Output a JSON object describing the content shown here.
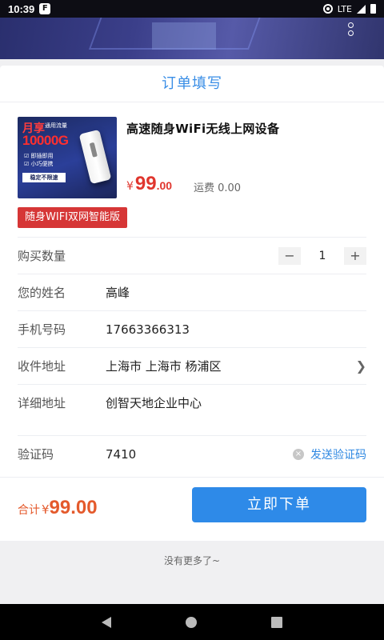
{
  "status_bar": {
    "time": "10:39",
    "notif_icon": "F",
    "network": "LTE"
  },
  "header": {
    "title": "订单填写"
  },
  "product": {
    "thumb": {
      "brand": "月享",
      "traffic_label": "通用流量",
      "traffic": "10000G",
      "feature1": "☑ 即插即用",
      "feature2": "☑ 小巧便携",
      "badge": "稳定不限速"
    },
    "name": "高速随身WiFi无线上网设备",
    "price_currency": "¥",
    "price_int": "99",
    "price_dec": ".00",
    "shipping": "运费 0.00",
    "variant_tag": "随身WIFI双网智能版"
  },
  "form": {
    "quantity": {
      "label": "购买数量",
      "minus": "−",
      "value": "1",
      "plus": "+"
    },
    "name": {
      "label": "您的姓名",
      "value": "高峰"
    },
    "phone": {
      "label": "手机号码",
      "value": "17663366313"
    },
    "region": {
      "label": "收件地址",
      "value": "上海市 上海市 杨浦区"
    },
    "address": {
      "label": "详细地址",
      "value": "创智天地企业中心"
    },
    "verify": {
      "label": "验证码",
      "value": "7410",
      "clear": "×",
      "send_label": "发送验证码"
    }
  },
  "summary": {
    "total_label": "合计",
    "currency": "¥",
    "amount": "99.00",
    "order_button": "立即下单"
  },
  "footer": {
    "text": "没有更多了~"
  },
  "colors": {
    "accent": "#2e8ae8",
    "price": "#e0362e",
    "tag": "#d63636"
  }
}
